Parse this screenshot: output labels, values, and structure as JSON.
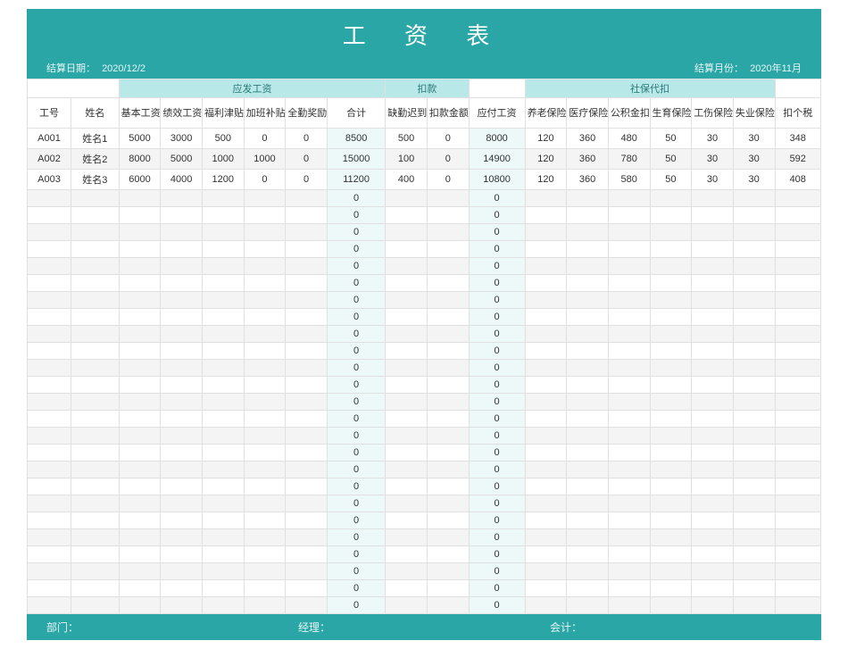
{
  "title": "工 资 表",
  "meta": {
    "settle_date_label": "结算日期：",
    "settle_date": "2020/12/2",
    "settle_month_label": "结算月份：",
    "settle_month": "2020年11月"
  },
  "group_headers": {
    "payable": "应发工资",
    "deduct": "扣款",
    "social": "社保代扣"
  },
  "columns": {
    "id": "工号",
    "name": "姓名",
    "base": "基本工资",
    "perf": "绩效工资",
    "welfare": "福利津贴",
    "overtime": "加班补贴",
    "attend": "全勤奖励",
    "total": "合计",
    "late": "缺勤迟到",
    "fine": "扣款金额",
    "due": "应付工资",
    "pension": "养老保险",
    "medical": "医疗保险",
    "fund": "公积金扣除",
    "birth": "生育保险扣除",
    "injury": "工伤保险",
    "unemp": "失业保险扣除",
    "tax": "扣个税"
  },
  "rows": [
    {
      "id": "A001",
      "name": "姓名1",
      "base": 5000,
      "perf": 3000,
      "welfare": 500,
      "overtime": 0,
      "attend": 0,
      "total": 8500,
      "late": 500,
      "fine": 0,
      "due": 8000,
      "pension": 120,
      "medical": 360,
      "fund": 480,
      "birth": 50,
      "injury": 30,
      "unemp": 30,
      "tax": 348
    },
    {
      "id": "A002",
      "name": "姓名2",
      "base": 8000,
      "perf": 5000,
      "welfare": 1000,
      "overtime": 1000,
      "attend": 0,
      "total": 15000,
      "late": 100,
      "fine": 0,
      "due": 14900,
      "pension": 120,
      "medical": 360,
      "fund": 780,
      "birth": 50,
      "injury": 30,
      "unemp": 30,
      "tax": 592
    },
    {
      "id": "A003",
      "name": "姓名3",
      "base": 6000,
      "perf": 4000,
      "welfare": 1200,
      "overtime": 0,
      "attend": 0,
      "total": 11200,
      "late": 400,
      "fine": 0,
      "due": 10800,
      "pension": 120,
      "medical": 360,
      "fund": 580,
      "birth": 50,
      "injury": 30,
      "unemp": 30,
      "tax": 408
    }
  ],
  "empty_row_count": 25,
  "empty_defaults": {
    "total": 0,
    "due": 0
  },
  "footer": {
    "dept": "部门：",
    "manager": "经理：",
    "account": "会计："
  }
}
